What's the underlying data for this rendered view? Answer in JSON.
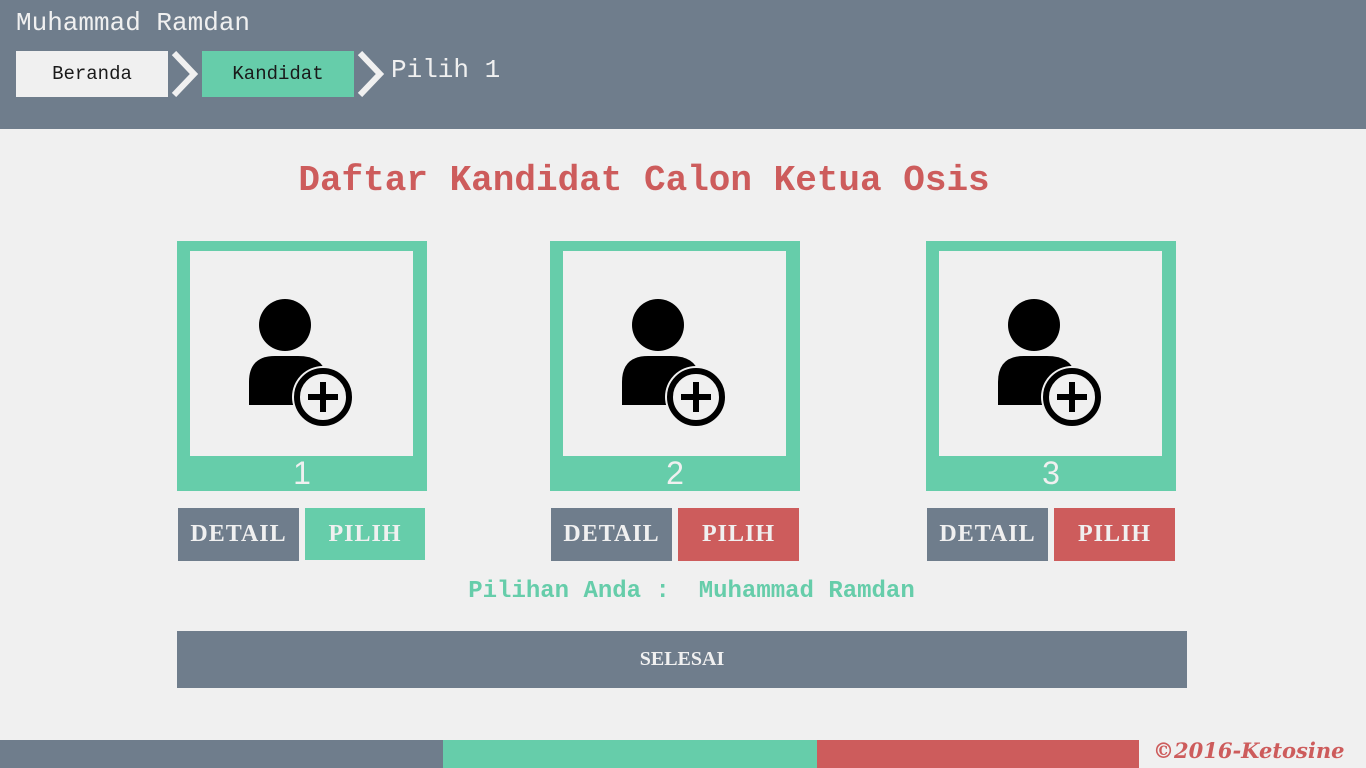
{
  "header": {
    "user_name": "Muhammad Ramdan",
    "breadcrumb": {
      "home": "Beranda",
      "kandidat": "Kandidat",
      "current": "Pilih 1"
    }
  },
  "main": {
    "title": "Daftar Kandidat Calon Ketua Osis",
    "candidates": [
      {
        "number": "1",
        "detail_label": "DETAIL",
        "pilih_label": "PILIH",
        "pilih_state": "selected"
      },
      {
        "number": "2",
        "detail_label": "DETAIL",
        "pilih_label": "PILIH",
        "pilih_state": "available"
      },
      {
        "number": "3",
        "detail_label": "DETAIL",
        "pilih_label": "PILIH",
        "pilih_state": "available"
      }
    ],
    "choice_label": "Pilihan Anda :",
    "choice_value": "Muhammad Ramdan",
    "finish_label": "SELESAI"
  },
  "footer": {
    "copyright": "©2016-Ketosine"
  },
  "icons": {
    "candidate_photo": "add-user-icon",
    "breadcrumb_separator": "chevron-right-icon"
  },
  "colors": {
    "slate": "#6f7d8c",
    "green": "#66cdaa",
    "red": "#cd5c5c",
    "background": "#f0f0f0"
  }
}
